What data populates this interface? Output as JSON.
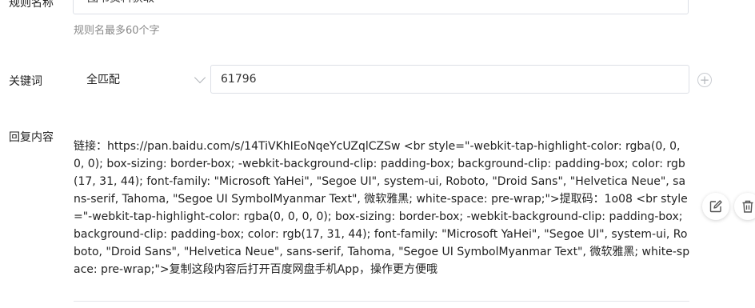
{
  "rule_name": {
    "label": "规则名称",
    "value": "图书资料获取",
    "hint": "规则名最多60个字"
  },
  "keyword": {
    "label": "关键词",
    "match_mode": "全匹配",
    "value": "61796"
  },
  "reply": {
    "label": "回复内容",
    "content": "链接：https://pan.baidu.com/s/14TiVKhIEoNqeYcUZqlCZSw <br style=\"-webkit-tap-highlight-color: rgba(0, 0, 0, 0); box-sizing: border-box; -webkit-background-clip: padding-box; background-clip: padding-box; color: rgb(17, 31, 44); font-family: \"Microsoft YaHei\", \"Segoe UI\", system-ui, Roboto, \"Droid Sans\", \"Helvetica Neue\", sans-serif, Tahoma, \"Segoe UI SymbolMyanmar Text\", 微软雅黑; white-space: pre-wrap;\">提取码：1o08 <br style=\"-webkit-tap-highlight-color: rgba(0, 0, 0, 0); box-sizing: border-box; -webkit-background-clip: padding-box; background-clip: padding-box; color: rgb(17, 31, 44); font-family: \"Microsoft YaHei\", \"Segoe UI\", system-ui, Roboto, \"Droid Sans\", \"Helvetica Neue\", sans-serif, Tahoma, \"Segoe UI SymbolMyanmar Text\", 微软雅黑; white-space: pre-wrap;\">复制这段内容后打开百度网盘手机App，操作更方便哦"
  },
  "icons": {
    "add": "plus-circle-icon",
    "edit": "edit-icon",
    "delete": "trash-icon"
  }
}
